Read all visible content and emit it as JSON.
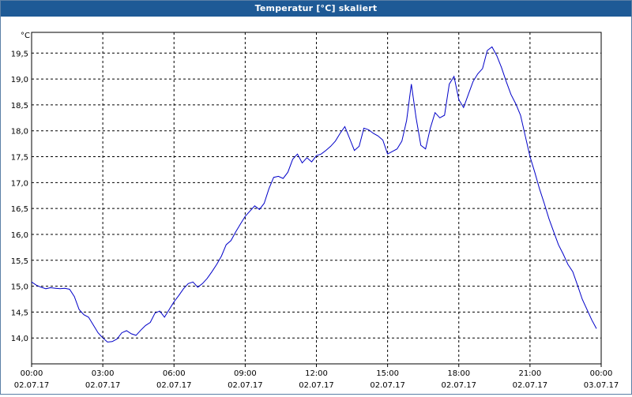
{
  "window": {
    "title": "Temperatur [°C] skaliert"
  },
  "chart_data": {
    "type": "line",
    "title": "Temperatur [°C] skaliert",
    "ylabel": "°C",
    "xlabel": "",
    "xlim_hours": [
      0,
      24
    ],
    "ylim": [
      13.5,
      19.9
    ],
    "grid": true,
    "y_ticks": [
      {
        "value": 14.0,
        "label": "14,0"
      },
      {
        "value": 14.5,
        "label": "14,5"
      },
      {
        "value": 15.0,
        "label": "15,0"
      },
      {
        "value": 15.5,
        "label": "15,5"
      },
      {
        "value": 16.0,
        "label": "16,0"
      },
      {
        "value": 16.5,
        "label": "16,5"
      },
      {
        "value": 17.0,
        "label": "17,0"
      },
      {
        "value": 17.5,
        "label": "17,5"
      },
      {
        "value": 18.0,
        "label": "18,0"
      },
      {
        "value": 18.5,
        "label": "18,5"
      },
      {
        "value": 19.0,
        "label": "19,0"
      },
      {
        "value": 19.5,
        "label": "19,5"
      }
    ],
    "x_ticks": [
      {
        "hour": 0,
        "time": "00:00",
        "date": "02.07.17"
      },
      {
        "hour": 3,
        "time": "03:00",
        "date": "02.07.17"
      },
      {
        "hour": 6,
        "time": "06:00",
        "date": "02.07.17"
      },
      {
        "hour": 9,
        "time": "09:00",
        "date": "02.07.17"
      },
      {
        "hour": 12,
        "time": "12:00",
        "date": "02.07.17"
      },
      {
        "hour": 15,
        "time": "15:00",
        "date": "02.07.17"
      },
      {
        "hour": 18,
        "time": "18:00",
        "date": "02.07.17"
      },
      {
        "hour": 21,
        "time": "21:00",
        "date": "02.07.17"
      },
      {
        "hour": 24,
        "time": "00:00",
        "date": "03.07.17"
      }
    ],
    "series": [
      {
        "color": "#0000c8",
        "x_hours": [
          0.0,
          0.2,
          0.4,
          0.6,
          0.8,
          1.0,
          1.2,
          1.4,
          1.6,
          1.8,
          2.0,
          2.2,
          2.4,
          2.6,
          2.8,
          3.0,
          3.2,
          3.4,
          3.6,
          3.8,
          4.0,
          4.2,
          4.4,
          4.6,
          4.8,
          5.0,
          5.2,
          5.4,
          5.6,
          5.8,
          6.0,
          6.2,
          6.4,
          6.6,
          6.8,
          7.0,
          7.2,
          7.4,
          7.6,
          7.8,
          8.0,
          8.2,
          8.4,
          8.6,
          8.8,
          9.0,
          9.2,
          9.4,
          9.6,
          9.8,
          10.0,
          10.2,
          10.4,
          10.6,
          10.8,
          11.0,
          11.2,
          11.4,
          11.6,
          11.8,
          12.0,
          12.2,
          12.4,
          12.6,
          12.8,
          13.0,
          13.2,
          13.4,
          13.6,
          13.8,
          14.0,
          14.2,
          14.4,
          14.6,
          14.8,
          15.0,
          15.2,
          15.4,
          15.6,
          15.8,
          16.0,
          16.2,
          16.4,
          16.6,
          16.8,
          17.0,
          17.2,
          17.4,
          17.6,
          17.8,
          18.0,
          18.2,
          18.4,
          18.6,
          18.8,
          19.0,
          19.2,
          19.4,
          19.6,
          19.8,
          20.0,
          20.2,
          20.4,
          20.6,
          20.8,
          21.0,
          21.2,
          21.4,
          21.6,
          21.8,
          22.0,
          22.2,
          22.4,
          22.6,
          22.8,
          23.0,
          23.2,
          23.4,
          23.6,
          23.8
        ],
        "values": [
          15.08,
          15.02,
          14.98,
          14.95,
          14.97,
          14.96,
          14.95,
          14.96,
          14.94,
          14.8,
          14.55,
          14.45,
          14.4,
          14.25,
          14.1,
          14.0,
          13.92,
          13.93,
          13.98,
          14.1,
          14.14,
          14.08,
          14.05,
          14.15,
          14.24,
          14.3,
          14.48,
          14.52,
          14.4,
          14.55,
          14.7,
          14.82,
          14.95,
          15.05,
          15.08,
          14.98,
          15.05,
          15.15,
          15.28,
          15.42,
          15.58,
          15.8,
          15.88,
          16.05,
          16.2,
          16.35,
          16.45,
          16.55,
          16.48,
          16.6,
          16.88,
          17.1,
          17.12,
          17.08,
          17.2,
          17.45,
          17.55,
          17.38,
          17.48,
          17.4,
          17.52,
          17.55,
          17.62,
          17.7,
          17.8,
          17.95,
          18.08,
          17.85,
          17.62,
          17.7,
          18.05,
          18.02,
          17.95,
          17.9,
          17.82,
          17.55,
          17.6,
          17.65,
          17.8,
          18.2,
          18.9,
          18.25,
          17.72,
          17.65,
          18.05,
          18.35,
          18.25,
          18.3,
          18.9,
          19.05,
          18.6,
          18.45,
          18.7,
          18.95,
          19.1,
          19.2,
          19.55,
          19.62,
          19.45,
          19.22,
          18.95,
          18.7,
          18.52,
          18.3,
          17.9,
          17.5,
          17.2,
          16.88,
          16.6,
          16.3,
          16.05,
          15.8,
          15.62,
          15.42,
          15.28,
          15.02,
          14.75,
          14.55,
          14.35,
          14.18,
          13.98
        ]
      }
    ]
  }
}
